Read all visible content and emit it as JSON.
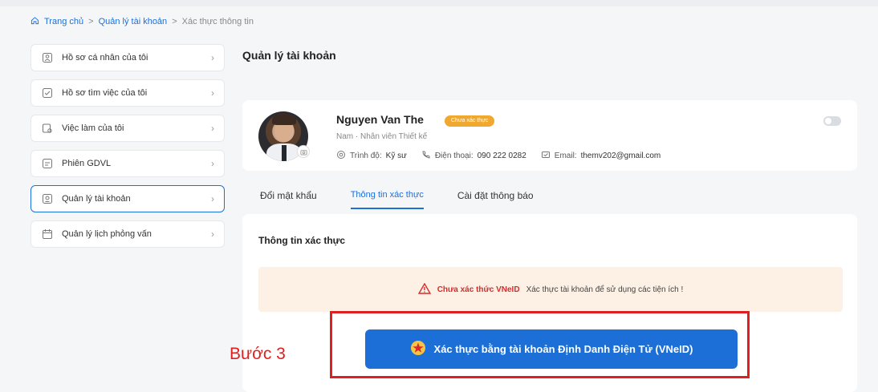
{
  "breadcrumb": {
    "home": "Trang chủ",
    "account": "Quản lý tài khoản",
    "current": "Xác thực thông tin",
    "sep": ">"
  },
  "sidebar": {
    "items": [
      {
        "label": "Hồ sơ cá nhân của tôi",
        "icon": "person-card-icon"
      },
      {
        "label": "Hồ sơ tìm việc của tôi",
        "icon": "resume-icon"
      },
      {
        "label": "Việc làm của tôi",
        "icon": "job-icon"
      },
      {
        "label": "Phiên GDVL",
        "icon": "session-icon"
      },
      {
        "label": "Quản lý tài khoản",
        "icon": "account-icon",
        "active": true
      },
      {
        "label": "Quản lý lịch phỏng vấn",
        "icon": "calendar-icon"
      }
    ]
  },
  "main": {
    "title": "Quản lý tài khoản",
    "profile": {
      "name": "Nguyen Van The",
      "badge": "Chưa xác thực",
      "subtitle": "Nam  ·  Nhân viên Thiết kế",
      "level_label": "Trình độ:",
      "level_value": "Kỹ sư",
      "phone_label": "Điện thoại:",
      "phone_value": "090 222 0282",
      "email_label": "Email:",
      "email_value": "themv202@gmail.com"
    },
    "tabs": [
      {
        "label": "Đổi mật khẩu"
      },
      {
        "label": "Thông tin xác thực",
        "active": true
      },
      {
        "label": "Cài đặt thông báo"
      }
    ],
    "panel": {
      "title": "Thông tin xác thực",
      "alert_strong": "Chưa xác thức VNeID",
      "alert_text": "Xác thực tài khoản để sử dụng các tiện ích !",
      "button": "Xác thực bằng tài khoản Định Danh Điện Tử (VNeID)"
    }
  },
  "annotation": {
    "step": "Bước 3"
  },
  "colors": {
    "primary": "#1d6fd8",
    "warning": "#f0a92e",
    "danger": "#e02020",
    "alert_bg": "#fdf1e6"
  }
}
